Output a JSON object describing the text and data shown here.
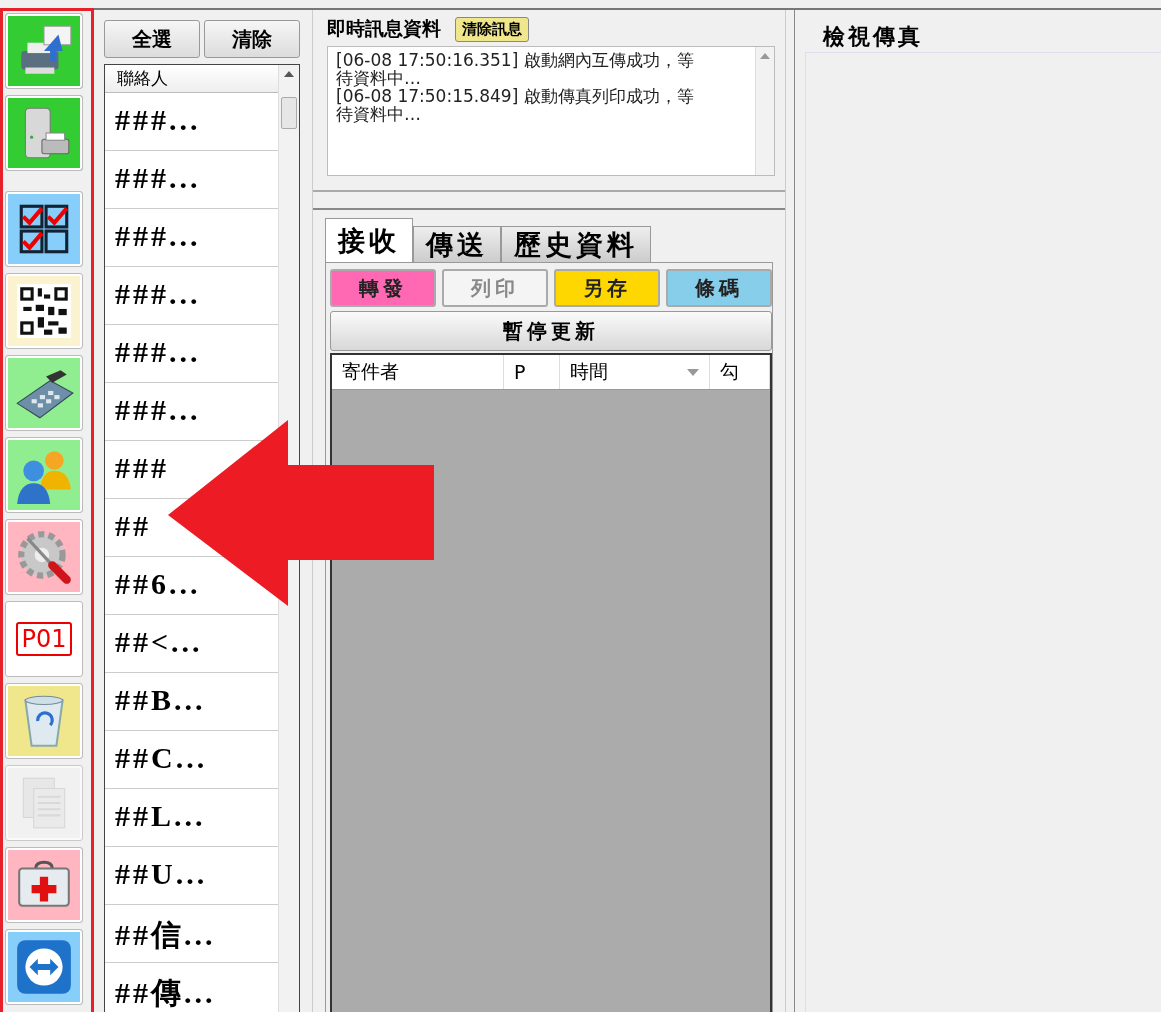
{
  "toolbar": {
    "groups": [
      [
        {
          "kind": "fax-printer",
          "color": "#33cc33",
          "disabled": false
        },
        {
          "kind": "server-printer",
          "color": "#33cc33",
          "disabled": false
        }
      ],
      [
        {
          "kind": "checklist",
          "color": "#87cefa",
          "disabled": false
        },
        {
          "kind": "qr-code",
          "color": "#fbf3d0",
          "disabled": false
        },
        {
          "kind": "calculator",
          "color": "#90ee90",
          "disabled": false
        },
        {
          "kind": "users",
          "color": "#90ee90",
          "disabled": false
        },
        {
          "kind": "settings-tools",
          "color": "#ffb6c1",
          "disabled": false
        },
        {
          "kind": "badge",
          "label": "P01",
          "color": "#ffffff",
          "disabled": false
        },
        {
          "kind": "recycle-bin",
          "color": "#f0e68c",
          "disabled": false
        },
        {
          "kind": "documents",
          "color": "#f2f2f2",
          "disabled": true
        },
        {
          "kind": "first-aid",
          "color": "#ffb6c1",
          "disabled": false
        },
        {
          "kind": "remote",
          "color": "#87cefa",
          "disabled": false
        }
      ]
    ]
  },
  "contacts": {
    "buttons": [
      "全選",
      "清除"
    ],
    "column": "聯絡人",
    "rows": [
      "###...",
      "###...",
      "###...",
      "###...",
      "###...",
      "###...",
      "###",
      "##",
      "##6...",
      "##<...",
      "##B...",
      "##C...",
      "##L...",
      "##U...",
      "##信...",
      "##傳..."
    ]
  },
  "messages": {
    "title": "即時訊息資料",
    "clear_button": "清除訊息",
    "log": [
      "[06-08 17:50:16.351] 啟動網內互傳成功，等待資料中…",
      "[06-08 17:50:15.849] 啟動傳真列印成功，等待資料中…"
    ]
  },
  "tabs": [
    {
      "label": "接收",
      "selected": true
    },
    {
      "label": "傳送",
      "selected": false
    },
    {
      "label": "歷史資料",
      "selected": false
    }
  ],
  "actions": [
    {
      "label": "轉發",
      "color": "#ff69b4",
      "disabled": false
    },
    {
      "label": "列印",
      "color": "#f4f4f4",
      "disabled": true
    },
    {
      "label": "另存",
      "color": "#ffd700",
      "disabled": false
    },
    {
      "label": "條碼",
      "color": "#87ceeb",
      "disabled": false
    }
  ],
  "pause_button": "暫停更新",
  "table": {
    "columns": [
      {
        "label": "寄件者",
        "sorted": false
      },
      {
        "label": "P",
        "sorted": false
      },
      {
        "label": "時間",
        "sorted": true
      },
      {
        "label": "勾",
        "sorted": false
      }
    ]
  },
  "fax_viewer": {
    "title": "檢視傳真"
  }
}
